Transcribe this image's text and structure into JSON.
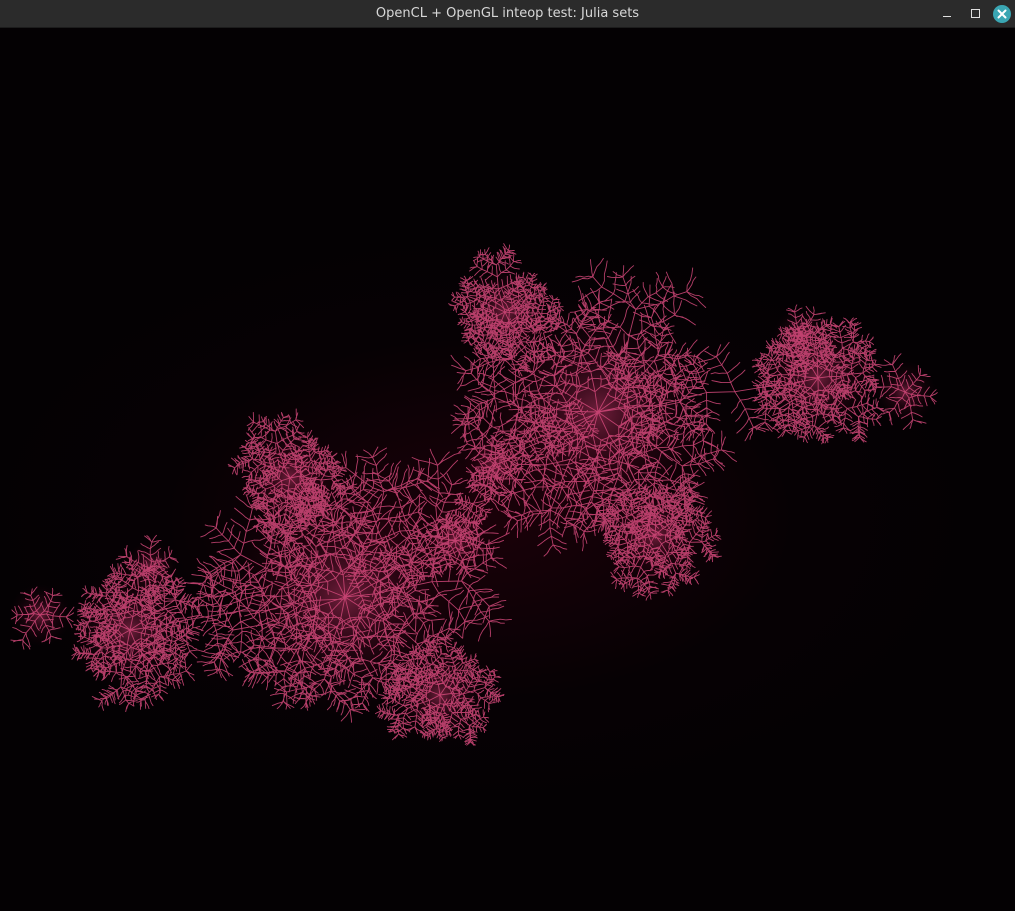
{
  "window": {
    "title": "OpenCL + OpenGL inteop test: Julia sets",
    "controls": {
      "minimize_icon": "minimize-icon",
      "maximize_icon": "maximize-icon",
      "close_icon": "close-icon"
    }
  },
  "colors": {
    "titlebar": "#2b2b2b",
    "title_text": "#d8d8d8",
    "close_button": "#3aa6b3",
    "background": "#040103",
    "fractal_glow": "#6e0a2a",
    "fractal_filament": "#d2497a"
  }
}
